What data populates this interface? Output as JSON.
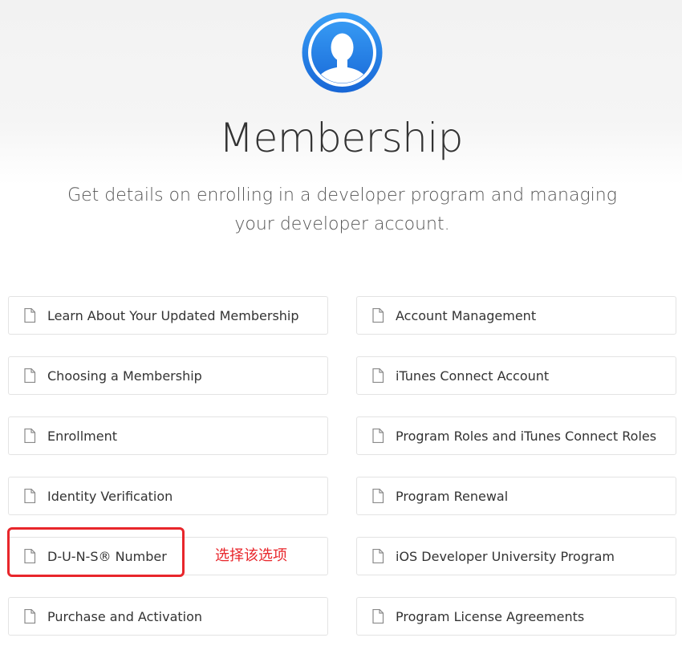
{
  "header": {
    "title": "Membership",
    "subtitle": "Get details on enrolling in a developer program and managing your developer account."
  },
  "colors": {
    "avatar_blue": "#1e7fe0",
    "annotation_red": "#e8262b",
    "card_border": "#e3e3e3"
  },
  "cards": {
    "left": [
      {
        "label": "Learn About Your Updated Membership"
      },
      {
        "label": "Choosing a Membership"
      },
      {
        "label": "Enrollment"
      },
      {
        "label": "Identity Verification"
      },
      {
        "label": "D-U-N-S® Number"
      },
      {
        "label": "Purchase and Activation"
      }
    ],
    "right": [
      {
        "label": "Account Management"
      },
      {
        "label": "iTunes Connect Account"
      },
      {
        "label": "Program Roles and iTunes Connect Roles"
      },
      {
        "label": "Program Renewal"
      },
      {
        "label": "iOS Developer University Program"
      },
      {
        "label": "Program License Agreements"
      }
    ]
  },
  "annotation": {
    "text": "选择该选项"
  },
  "icons": {
    "avatar": "person-silhouette-icon",
    "card": "document-icon"
  }
}
